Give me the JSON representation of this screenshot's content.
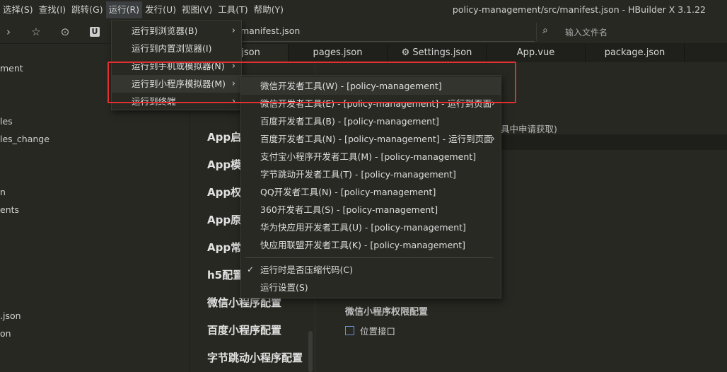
{
  "menubar": {
    "items": [
      "选择(S)",
      "查找(I)",
      "跳转(G)",
      "运行(R)",
      "发行(U)",
      "视图(V)",
      "工具(T)",
      "帮助(Y)"
    ],
    "window_title": "policy-management/src/manifest.json - HBuilder X 3.1.22"
  },
  "toolbar": {
    "icons": [
      "chevron-right-icon",
      "star-icon",
      "play-circle-icon",
      "uni-icon"
    ],
    "path": "manifest.json",
    "search_placeholder": "输入文件名"
  },
  "sidebar": {
    "items": [
      "ment",
      "les",
      "les_change",
      "n",
      "ents",
      ".json",
      "on"
    ]
  },
  "tabs": [
    {
      "label": ".json"
    },
    {
      "label": "pages.json"
    },
    {
      "label": "⚙ Settings.json"
    },
    {
      "label": "App.vue"
    },
    {
      "label": "package.json"
    }
  ],
  "main": {
    "nav": [
      "App启",
      "App模",
      "App权",
      "App原",
      "App常",
      "h5配置",
      "微信小程序配置",
      "百度小程序配置",
      "字节跳动小程序配置"
    ],
    "hint_text": "具中申请获取)",
    "perm_title": "微信小程序权限配置",
    "perm_checkbox_label": "位置接口"
  },
  "run_menu": {
    "items": [
      {
        "label": "运行到浏览器(B)",
        "has_submenu": true
      },
      {
        "label": "运行到内置浏览器(I)",
        "has_submenu": false
      },
      {
        "label": "运行到手机或模拟器(N)",
        "has_submenu": true
      },
      {
        "label": "运行到小程序模拟器(M)",
        "has_submenu": true
      },
      {
        "label": "运行到终端",
        "has_submenu": true
      }
    ]
  },
  "mp_submenu": {
    "items": [
      {
        "label": "微信开发者工具(W) - [policy-management]"
      },
      {
        "label": "微信开发者工具(E) - [policy-management] - 运行到页面",
        "has_submenu": true
      },
      {
        "label": "百度开发者工具(B) - [policy-management]"
      },
      {
        "label": "百度开发者工具(N) - [policy-management] - 运行到页面",
        "has_submenu": true
      },
      {
        "label": "支付宝小程序开发者工具(M) - [policy-management]"
      },
      {
        "label": "字节跳动开发者工具(T) - [policy-management]"
      },
      {
        "label": "QQ开发者工具(N) - [policy-management]"
      },
      {
        "label": "360开发者工具(S) - [policy-management]"
      },
      {
        "label": "华为快应用开发者工具(U) - [policy-management]"
      },
      {
        "label": "快应用联盟开发者工具(K) - [policy-management]"
      }
    ],
    "options": [
      {
        "label": "运行时是否压缩代码(C)",
        "checked": true
      },
      {
        "label": "运行设置(S)",
        "checked": false
      }
    ]
  },
  "colors": {
    "highlight_border": "#e03030",
    "background": "#272822"
  }
}
